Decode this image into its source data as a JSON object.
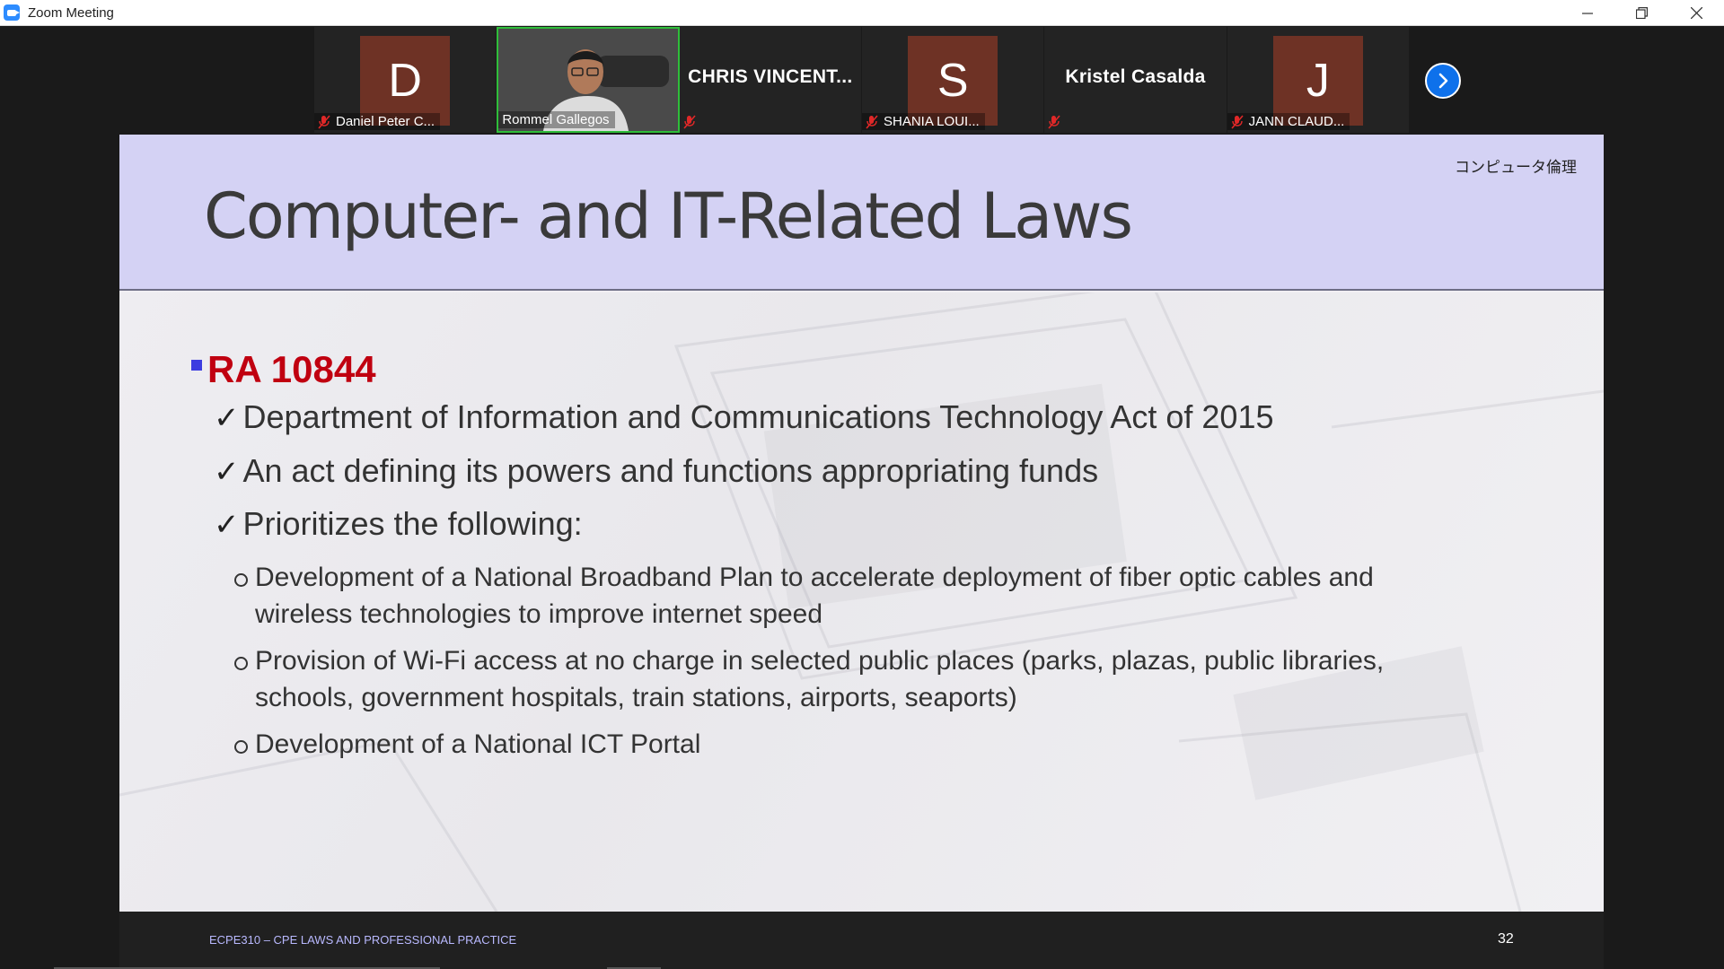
{
  "window": {
    "title": "Zoom Meeting",
    "controls": {
      "minimize": "—",
      "restore": "❐",
      "close": "✕"
    }
  },
  "participants": [
    {
      "type": "avatar",
      "initial": "D",
      "name": "Daniel Peter C...",
      "muted": true
    },
    {
      "type": "video",
      "name": "Rommel Gallegos",
      "muted": false,
      "active": true
    },
    {
      "type": "name",
      "display": "CHRIS  VINCENT...",
      "muted": true
    },
    {
      "type": "avatar",
      "initial": "S",
      "name": "SHANIA LOUI...",
      "muted": true
    },
    {
      "type": "name",
      "display": "Kristel Casalda",
      "muted": true
    },
    {
      "type": "avatar",
      "initial": "J",
      "name": "JANN CLAUD...",
      "muted": true
    }
  ],
  "gallery": {
    "next_icon": "chevron-right-icon"
  },
  "slide": {
    "title": "Computer- and IT-Related Laws",
    "corner_text": "コンピュータ倫理",
    "heading": "RA 10844",
    "points": [
      "Department of Information and Communications Technology Act of 2015",
      "An act defining its powers and functions appropriating funds",
      "Prioritizes the following:"
    ],
    "subpoints": [
      [
        "Development of a National Broadband Plan to accelerate deployment of fiber optic cables and",
        "wireless technologies to improve internet speed"
      ],
      [
        "Provision of Wi-Fi access at no charge in selected public places (parks, plazas, public libraries,",
        "schools, government hospitals, train stations, airports, seaports)"
      ],
      [
        "Development of a National ICT Portal"
      ]
    ],
    "footer_course": "ECPE310 – CPE LAWS AND PROFESSIONAL PRACTICE",
    "page_number": "32"
  },
  "colors": {
    "header_bg": "#d4d2f4",
    "heading_red": "#c00010",
    "bullet_blue": "#3c3ce0",
    "avatar_bg": "#6e3225",
    "active_speaker": "#2fbe3a",
    "zoom_blue": "#0e71eb"
  }
}
